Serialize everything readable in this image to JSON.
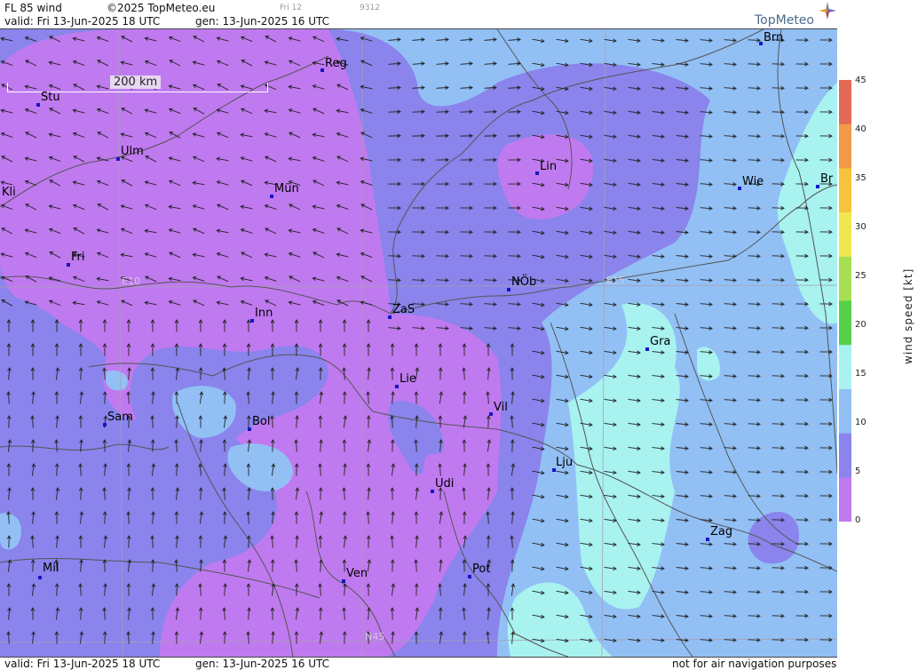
{
  "header": {
    "product": "FL 85 wind",
    "copyright": "©2025 TopMeteo.eu",
    "day_tag": "Fri 12",
    "code": "9312",
    "valid": "valid:  Fri  13-Jun-2025  18 UTC",
    "gen": "gen: 13-Jun-2025 16 UTC",
    "logo": "TopMeteo"
  },
  "footer": {
    "valid": "valid:  Fri  13-Jun-2025  18 UTC",
    "gen": "gen: 13-Jun-2025 16 UTC",
    "disclaimer": "not for air navigation purposes"
  },
  "legend": {
    "label": "wind  speed  [kt]",
    "ticks": [
      "45",
      "40",
      "35",
      "30",
      "25",
      "20",
      "15",
      "10",
      "5",
      "0"
    ],
    "colors": [
      "#e36a56",
      "#f09a4a",
      "#f5c43c",
      "#f0e650",
      "#a6e052",
      "#56d04a",
      "#a8f2f0",
      "#92c0f5",
      "#8a84ec",
      "#c07af0"
    ]
  },
  "map": {
    "scale_label": "200 km",
    "grid_labels": [
      "E10",
      "E15",
      "N45"
    ],
    "cities": [
      {
        "name": "Brn"
      },
      {
        "name": "Reg"
      },
      {
        "name": "Stu"
      },
      {
        "name": "Ulm"
      },
      {
        "name": "Mün"
      },
      {
        "name": "Kli"
      },
      {
        "name": "Lin"
      },
      {
        "name": "Wie"
      },
      {
        "name": "Br"
      },
      {
        "name": "Fri"
      },
      {
        "name": "NÖb"
      },
      {
        "name": "Inn"
      },
      {
        "name": "ZaS"
      },
      {
        "name": "Gra"
      },
      {
        "name": "Lie"
      },
      {
        "name": "Vil"
      },
      {
        "name": "Sam"
      },
      {
        "name": "Bol"
      },
      {
        "name": "Lju"
      },
      {
        "name": "Udi"
      },
      {
        "name": "Zag"
      },
      {
        "name": "Mil"
      },
      {
        "name": "Pot"
      },
      {
        "name": "Ven"
      }
    ]
  }
}
